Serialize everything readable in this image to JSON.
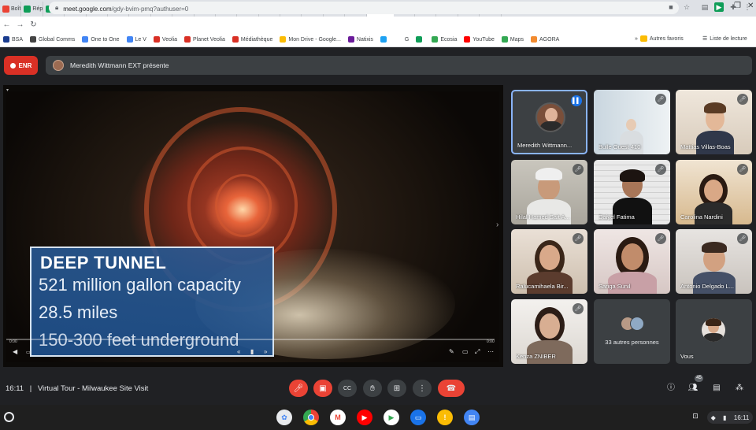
{
  "browser": {
    "tabs": [
      {
        "label": "Boît",
        "color": "#ea4335"
      },
      {
        "label": "Rép",
        "color": "#0f9d58"
      },
      {
        "label": "Sui",
        "color": "#0f9d58"
      },
      {
        "label": "DIG",
        "color": "#4285f4"
      },
      {
        "label": "Mai",
        "color": "#0f9d58"
      },
      {
        "label": "Pro",
        "color": "#4285f4"
      },
      {
        "label": "Inf",
        "color": "#4285f4"
      },
      {
        "label": "SUI",
        "color": "#fbbc04"
      },
      {
        "label": "Sui",
        "color": "#0f9d58"
      },
      {
        "label": "Dig",
        "color": "#f4b400"
      },
      {
        "label": "Pro",
        "color": "#f4b400"
      },
      {
        "label": "Bas",
        "color": "#0f9d58"
      },
      {
        "label": "The",
        "color": "#0f9d58"
      },
      {
        "label": "Pre",
        "color": "#f4b400"
      },
      {
        "label": "Glo",
        "color": "#0f9d58"
      },
      {
        "label": "Sui",
        "color": "#0f9d58"
      },
      {
        "label": "Cor",
        "color": "#4285f4"
      },
      {
        "label": "",
        "color": "#ea4335",
        "active": true
      },
      {
        "label": "Ves",
        "color": "#0f9d58"
      },
      {
        "label": "Gro",
        "color": "#4285f4"
      },
      {
        "label": "Not",
        "color": "#0a66c2"
      },
      {
        "label": "Mo",
        "color": "#4285f4"
      },
      {
        "label": "Glo",
        "color": "#0f9d58"
      }
    ],
    "new_tab": "+",
    "url_host": "meet.google.com",
    "url_path": "/gdy-bvim-pmq?authuser=0",
    "bookmarks": [
      {
        "label": "BSA",
        "color": "#1a3c8f"
      },
      {
        "label": "Global Comms",
        "color": "#444"
      },
      {
        "label": "One to One",
        "color": "#4285f4"
      },
      {
        "label": "Le V",
        "color": "#4285f4"
      },
      {
        "label": "Veolia",
        "color": "#d93025"
      },
      {
        "label": "Planet Veolia",
        "color": "#d93025"
      },
      {
        "label": "Médiathèque",
        "color": "#d93025"
      },
      {
        "label": "Mon Drive - Google...",
        "color": "#fbbc04"
      },
      {
        "label": "Natixis",
        "color": "#6a1b9a"
      },
      {
        "label": "",
        "color": "#1da1f2"
      },
      {
        "label": "G",
        "color": "#fff"
      },
      {
        "label": "",
        "color": "#0f9d58"
      },
      {
        "label": "Ecosia",
        "color": "#34a853"
      },
      {
        "label": "YouTube",
        "color": "#ff0000"
      },
      {
        "label": "Maps",
        "color": "#34a853"
      },
      {
        "label": "AGORA",
        "color": "#f28b30"
      }
    ],
    "other_favorites": "Autres favoris",
    "reading_list": "Liste de lecture"
  },
  "meet": {
    "record_label": "ENR",
    "presenter_text": "Meredith Wittmann EXT présente",
    "slide": {
      "title": "DEEP TUNNEL",
      "line1": "521 million gallon capacity",
      "line2": "28.5 miles",
      "line3": "150-300 feet underground"
    },
    "video": {
      "elapsed": "0:00",
      "duration": "0:00"
    },
    "participants": [
      {
        "name": "Meredith Wittmann...",
        "speaking": true
      },
      {
        "name": "Bulle Ouest 410"
      },
      {
        "name": "Mattias Villas-Boas"
      },
      {
        "name": "Hilal Hamed Sait A..."
      },
      {
        "name": "Daiyel Fatima"
      },
      {
        "name": "Carolina Nardini"
      },
      {
        "name": "Ralucamihaela Bir..."
      },
      {
        "name": "Sariga Sunil"
      },
      {
        "name": "Antonio Delgado L..."
      },
      {
        "name": "Kenza ZNIBER"
      },
      {
        "name": "33 autres personnes"
      },
      {
        "name": "Vous"
      }
    ],
    "meeting_time": "16:11",
    "meeting_title": "Virtual Tour - Milwaukee Site Visit",
    "separator": "|",
    "participant_count": "45"
  },
  "shelf": {
    "clock": "16:11"
  },
  "colors": {
    "record_red": "#d93025",
    "speaking_blue": "#8ab4f8",
    "hangup_red": "#ea4335",
    "bar_dark": "#202124",
    "tile_gray": "#3c4043"
  }
}
